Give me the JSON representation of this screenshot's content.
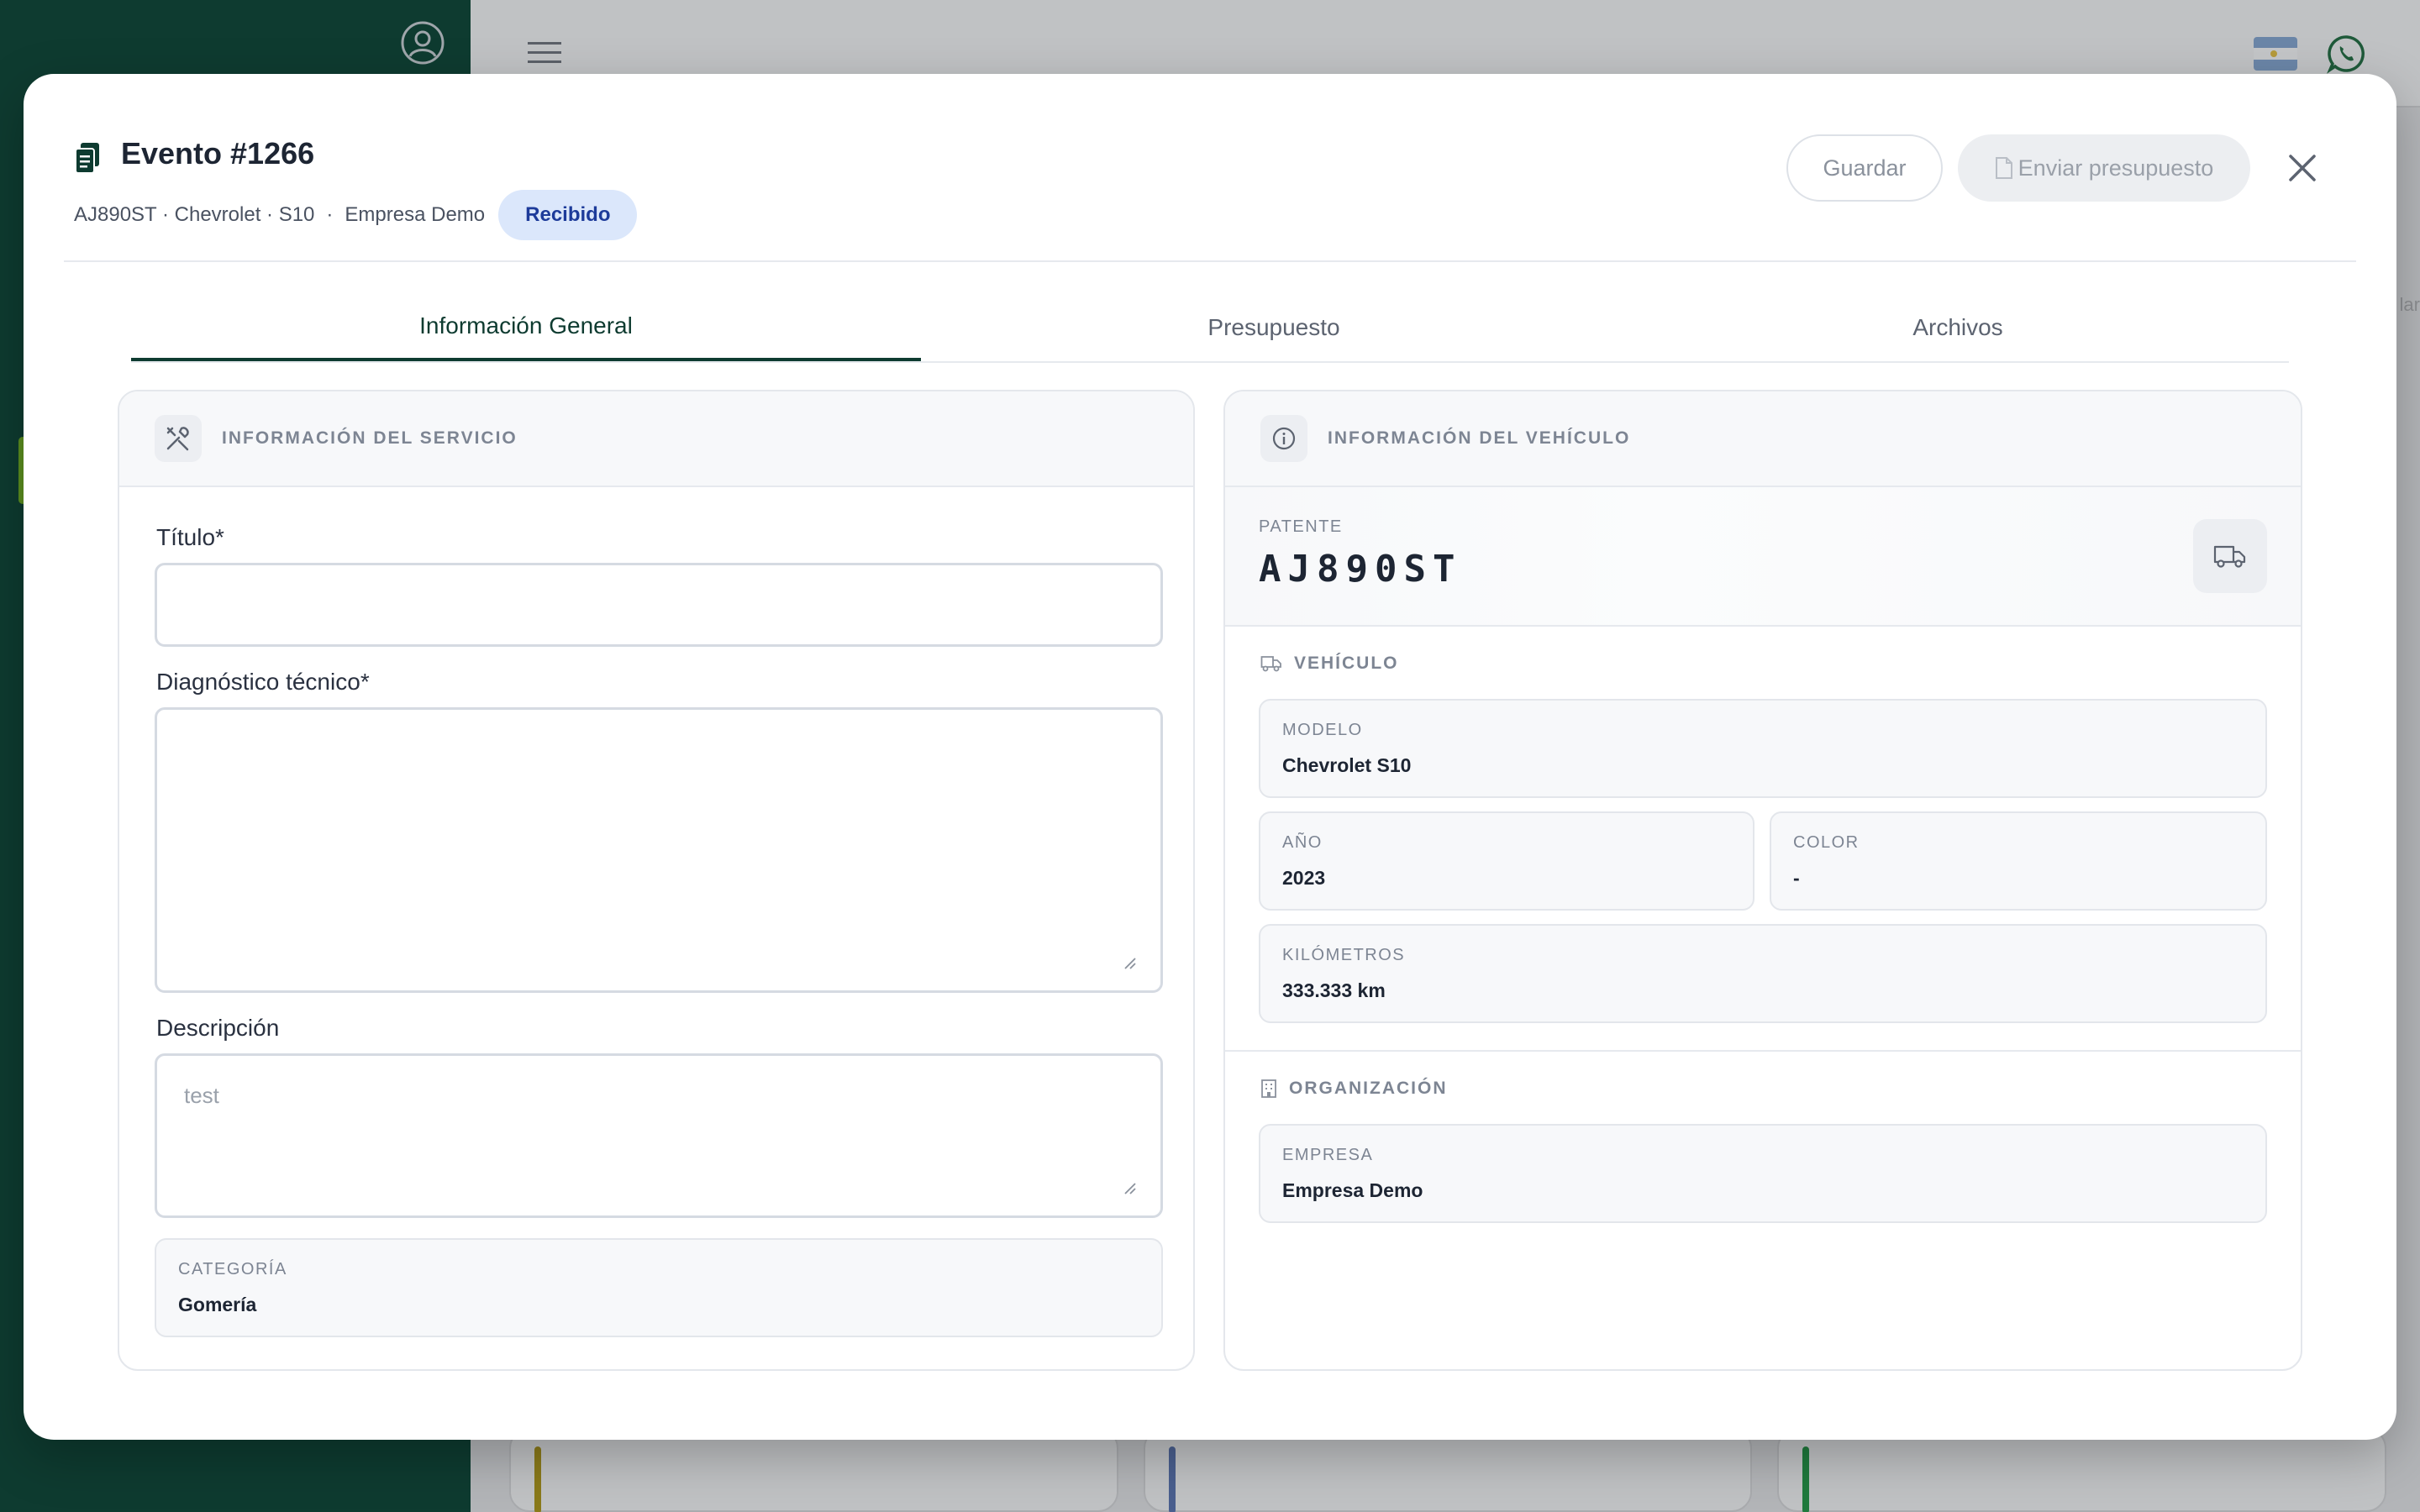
{
  "event": {
    "title": "Evento #1266",
    "plate": "AJ890ST",
    "make": "Chevrolet",
    "model": "S10",
    "separator": "·",
    "company": "Empresa Demo",
    "status": "Recibido"
  },
  "actions": {
    "save_label": "Guardar",
    "send_label": "Enviar presupuesto"
  },
  "tabs": [
    {
      "label": "Información General",
      "active": true
    },
    {
      "label": "Presupuesto",
      "active": false
    },
    {
      "label": "Archivos",
      "active": false
    }
  ],
  "service": {
    "header": "INFORMACIÓN DEL SERVICIO",
    "title_label": "Título",
    "title_value": "",
    "required_mark": "*",
    "diagnosis_label": "Diagnóstico técnico",
    "diagnosis_value": "",
    "description_label": "Descripción",
    "description_placeholder": "test",
    "category_label": "CATEGORÍA",
    "category_value": "Gomería"
  },
  "vehicle": {
    "header": "INFORMACIÓN DEL VEHÍCULO",
    "plate_label": "PATENTE",
    "plate_value": "AJ890ST",
    "section_label": "VEHÍCULO",
    "model_label": "MODELO",
    "model_value": "Chevrolet S10",
    "year_label": "AÑO",
    "year_value": "2023",
    "color_label": "COLOR",
    "color_value": "-",
    "km_label": "KILÓMETROS",
    "km_value": "333.333 km"
  },
  "organization": {
    "section_label": "ORGANIZACIÓN",
    "company_label": "EMPRESA",
    "company_value": "Empresa Demo"
  },
  "colors": {
    "brand_dark_green": "#0e3b30",
    "badge_bg": "#dbe7fb",
    "badge_text": "#1d3b9a"
  },
  "icons": {
    "title": "clipboard-copy-icon",
    "close": "close-icon",
    "service": "tools-icon",
    "vehicle": "info-icon",
    "plate": "truck-icon",
    "org": "building-icon"
  }
}
